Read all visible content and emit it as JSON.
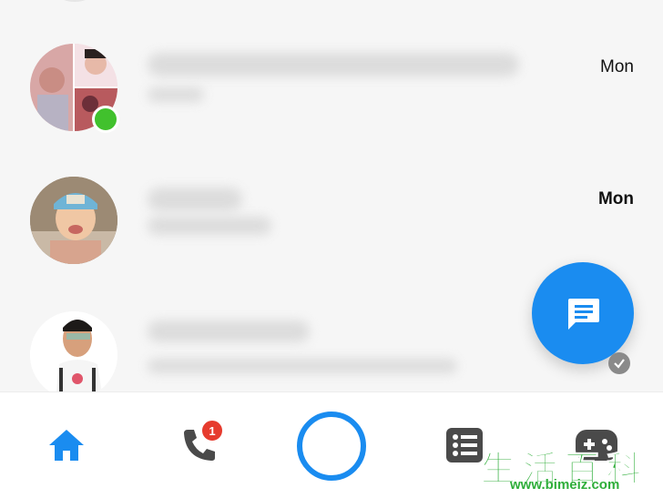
{
  "conversations": [
    {
      "time": "Mon",
      "time_bold": false,
      "online": true,
      "avatar_icon": "group-avatar"
    },
    {
      "time": "Mon",
      "time_bold": true,
      "online": false,
      "avatar_icon": "child-avatar"
    },
    {
      "time": "",
      "time_bold": false,
      "online": false,
      "avatar_icon": "man-avatar",
      "seen": true
    }
  ],
  "fab": {
    "icon": "new-message-icon"
  },
  "tabbar": {
    "tabs": [
      {
        "icon": "home-icon",
        "active": true
      },
      {
        "icon": "phone-icon",
        "badge": "1"
      },
      {
        "icon": "camera-icon"
      },
      {
        "icon": "people-list-icon"
      },
      {
        "icon": "games-icon"
      }
    ]
  },
  "watermark": {
    "chinese": "生活百科",
    "url": "www.bimeiz.com"
  },
  "colors": {
    "accent": "#1a8cf0",
    "online": "#41c12d",
    "badge": "#e63b2e"
  }
}
